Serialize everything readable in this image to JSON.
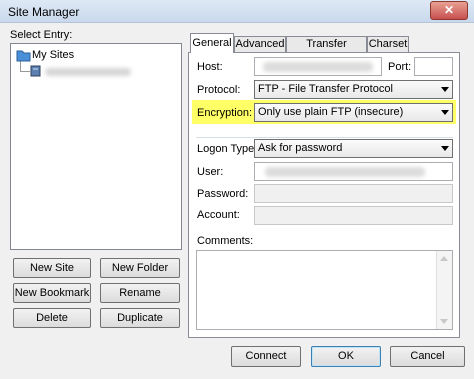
{
  "window": {
    "title": "Site Manager",
    "close_label": "✕"
  },
  "left": {
    "select_entry_label": "Select Entry:",
    "tree_root": "My Sites",
    "buttons": {
      "new_site": "New Site",
      "new_folder": "New Folder",
      "new_bookmark": "New Bookmark",
      "rename": "Rename",
      "delete": "Delete",
      "duplicate": "Duplicate"
    }
  },
  "tabs": [
    "General",
    "Advanced",
    "Transfer Settings",
    "Charset"
  ],
  "general": {
    "host_label": "Host:",
    "port_label": "Port:",
    "protocol_label": "Protocol:",
    "protocol_value": "FTP - File Transfer Protocol",
    "encryption_label": "Encryption:",
    "encryption_value": "Only use plain FTP (insecure)",
    "logon_label": "Logon Type:",
    "logon_value": "Ask for password",
    "user_label": "User:",
    "password_label": "Password:",
    "account_label": "Account:",
    "comments_label": "Comments:"
  },
  "highlight_color": "#ffff66",
  "footer": {
    "connect": "Connect",
    "ok": "OK",
    "cancel": "Cancel"
  }
}
